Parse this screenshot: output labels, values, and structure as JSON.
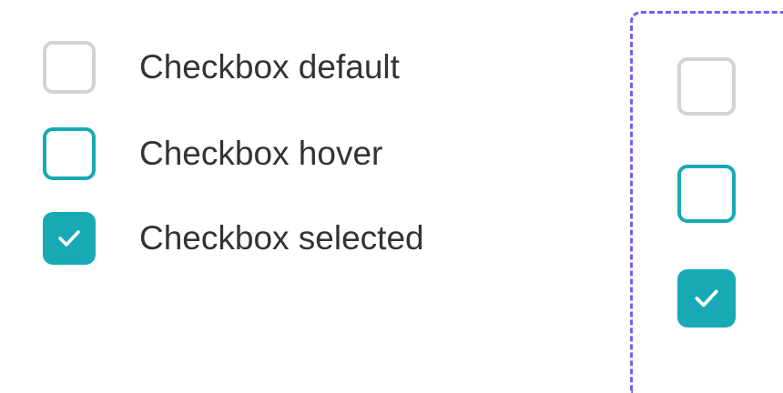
{
  "checkbox_states": [
    {
      "state": "default",
      "label": "Checkbox default",
      "checked": false
    },
    {
      "state": "hover",
      "label": "Checkbox hover",
      "checked": false
    },
    {
      "state": "selected",
      "label": "Checkbox selected",
      "checked": true
    }
  ],
  "colors": {
    "default_border": "#d3d3d3",
    "accent": "#17aab5",
    "check": "#ffffff",
    "label_text": "#333333",
    "frame_dashed": "#7b5cf0"
  },
  "icons": {
    "selected_mark": "checkmark-icon"
  }
}
